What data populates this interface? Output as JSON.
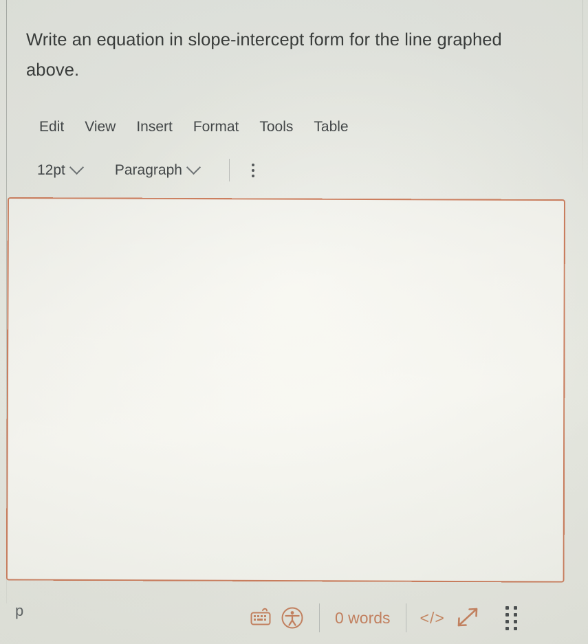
{
  "question": {
    "text": "Write an equation in slope-intercept form for the line graphed above."
  },
  "menubar": {
    "items": [
      {
        "label": "Edit"
      },
      {
        "label": "View"
      },
      {
        "label": "Insert"
      },
      {
        "label": "Format"
      },
      {
        "label": "Tools"
      },
      {
        "label": "Table"
      }
    ]
  },
  "toolbar": {
    "font_size": {
      "value": "12pt",
      "icon": "chevron-down-icon"
    },
    "block_format": {
      "value": "Paragraph",
      "icon": "chevron-down-icon"
    },
    "more_menu": {
      "icon": "kebab-menu-icon"
    }
  },
  "editor": {
    "content": "",
    "placeholder": ""
  },
  "statusbar": {
    "element_path": "p",
    "keyboard_icon": "keyboard-icon",
    "accessibility_icon": "accessibility-checker-icon",
    "word_count": "0 words",
    "source_code_icon": "code-brackets-icon",
    "fullscreen_icon": "diagonal-resize-arrow-icon",
    "resize_grip_icon": "resize-grip-dots-icon"
  },
  "colors": {
    "accent": "#cd8460",
    "editor_border": "#d4805e",
    "page_background": "#e5e8e2",
    "editor_background": "#f8f8f4",
    "text": "#3a3d3c",
    "menu_text": "#44484a"
  }
}
